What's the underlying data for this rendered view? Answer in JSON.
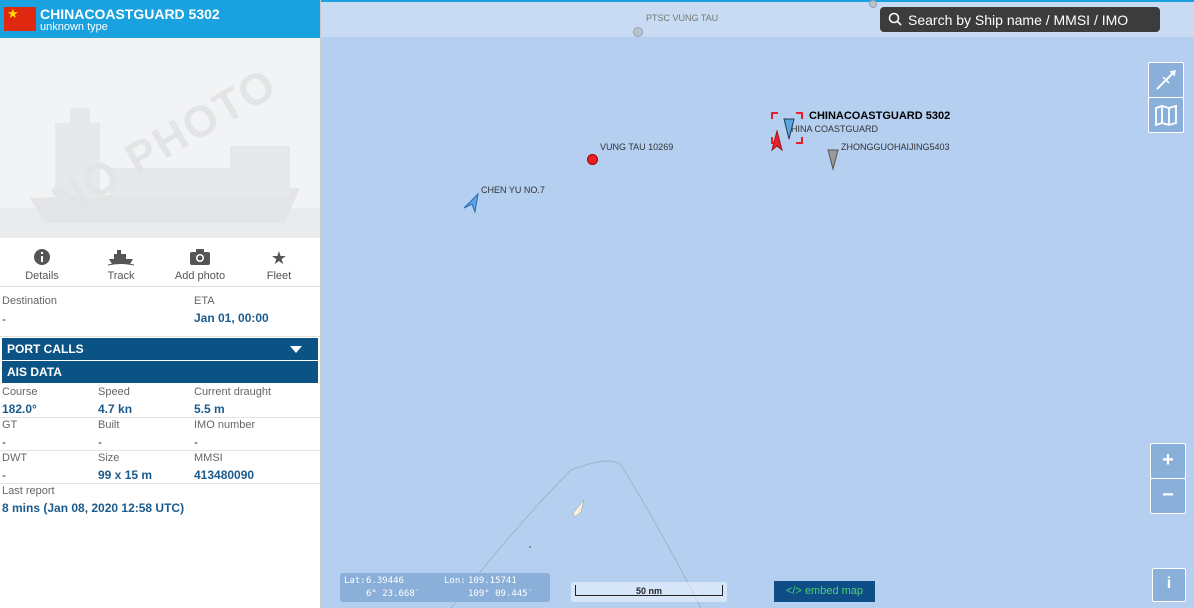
{
  "vessel": {
    "name": "CHINACOASTGUARD 5302",
    "type": "unknown type",
    "photo_placeholder": "NO PHOTO",
    "flag_color": "#de2910"
  },
  "actions": [
    {
      "label": "Details",
      "icon": "info-icon"
    },
    {
      "label": "Track",
      "icon": "ship-track-icon"
    },
    {
      "label": "Add photo",
      "icon": "camera-icon"
    },
    {
      "label": "Fleet",
      "icon": "star-icon"
    }
  ],
  "voyage": {
    "destination_label": "Destination",
    "destination_value": "-",
    "eta_label": "ETA",
    "eta_value": "Jan 01, 00:00"
  },
  "sections": {
    "port_calls": "PORT CALLS",
    "ais_data": "AIS DATA"
  },
  "ais": {
    "course_label": "Course",
    "course_value": "182.0°",
    "speed_label": "Speed",
    "speed_value": "4.7 kn",
    "draught_label": "Current draught",
    "draught_value": "5.5 m",
    "gt_label": "GT",
    "gt_value": "-",
    "built_label": "Built",
    "built_value": "-",
    "imo_label": "IMO number",
    "imo_value": "-",
    "dwt_label": "DWT",
    "dwt_value": "-",
    "size_label": "Size",
    "size_value": "99 x 15 m",
    "mmsi_label": "MMSI",
    "mmsi_value": "413480090",
    "last_report_label": "Last report",
    "last_report_value": "8 mins (Jan 08, 2020 12:58 UTC)"
  },
  "map": {
    "search_placeholder": "Search by Ship name / MMSI / IMO",
    "labels": {
      "ptsc": "PTSC VUNG TAU",
      "vungtau": "VUNG TAU 10269",
      "chenyu": "CHEN YU NO.7",
      "selected": "CHINACOASTGUARD 5302",
      "chinacg": "HINA COASTGUARD",
      "zhong": "ZHONGGUOHAIJING5403"
    },
    "zoom_in": "+",
    "zoom_out": "−",
    "info": "i",
    "scale": "50 nm",
    "embed": "</> embed map",
    "lat_label": "Lat:",
    "lat_dec": "6.39446",
    "lat_dms": "6° 23.668′",
    "lon_label": "Lon:",
    "lon_dec": "109.15741",
    "lon_dms": "109° 09.445′"
  },
  "colors": {
    "header": "#1aa1e0",
    "section": "#0b5384",
    "value": "#1b5a8c",
    "sea": "#b4cff0",
    "selected_ship": "#e8202a"
  }
}
